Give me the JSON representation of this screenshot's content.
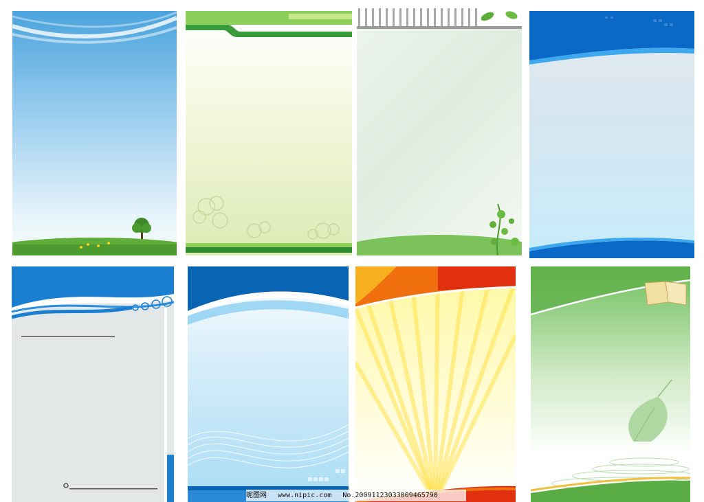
{
  "watermark": {
    "site_name": "昵图网",
    "url": "www.nipic.com",
    "number": "No.20091123033009465790"
  },
  "panels": [
    {
      "name": "blue-sky-tree-template",
      "colors": {
        "top": "#4aa3dc",
        "bottom": "#f4faf6",
        "grass": "#5fae3a"
      }
    },
    {
      "name": "green-header-cloud-template",
      "colors": {
        "band": "#3a9b3a",
        "bg": "#f4f8df"
      }
    },
    {
      "name": "vine-stripes-template",
      "colors": {
        "stripes": "#9a9a9a",
        "leaves": "#5fae3a"
      }
    },
    {
      "name": "blue-wave-gray-template",
      "colors": {
        "wave": "#0a68c7",
        "bg": "#c7ecfa"
      }
    },
    {
      "name": "blue-wave-gray-form-template",
      "colors": {
        "wave": "#1a7fd0",
        "bg": "#e4e7e8"
      }
    },
    {
      "name": "blue-ribbon-template",
      "colors": {
        "header": "#0a64b4",
        "bg": "#a8dcf4"
      }
    },
    {
      "name": "sunburst-template",
      "colors": {
        "orange": "#f07010",
        "red": "#e03010",
        "yellow": "#fff8a0"
      }
    },
    {
      "name": "green-book-leaf-template",
      "colors": {
        "top": "#6fbf5c",
        "leaf": "#a8d49a"
      }
    }
  ]
}
